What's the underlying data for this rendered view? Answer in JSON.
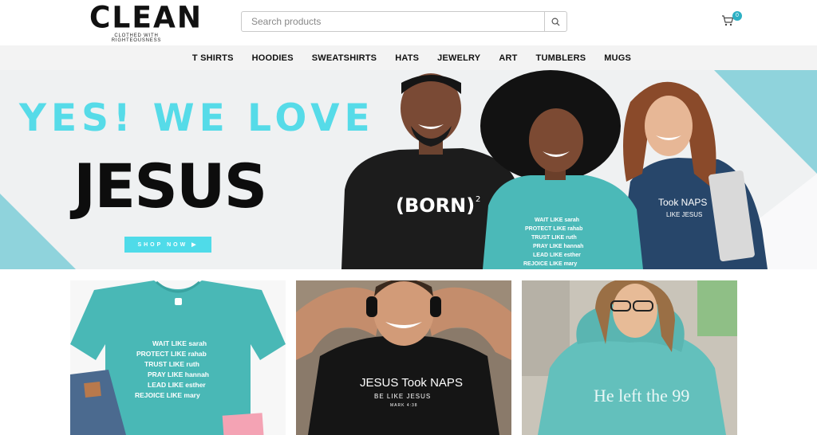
{
  "header": {
    "logo_title": "CLEAN",
    "logo_tagline": "CLOTHED WITH RIGHTEOUSNESS",
    "search_placeholder": "Search products",
    "cart_count": "0"
  },
  "nav": {
    "items": [
      "T SHIRTS",
      "HOODIES",
      "SWEATSHIRTS",
      "HATS",
      "JEWELRY",
      "ART",
      "TUMBLERS",
      "MUGS"
    ]
  },
  "hero": {
    "line1": "YES! WE LOVE",
    "line2": "JESUS",
    "cta": "SHOP NOW ▶",
    "shirt1": "(BORN)",
    "shirt1_sup": "2",
    "shirt2_lines": [
      "WAIT LIKE sarah",
      "PROTECT LIKE rahab",
      "TRUST LIKE ruth",
      "PRAY LIKE hannah",
      "LEAD LIKE esther",
      "REJOICE LIKE mary"
    ],
    "shirt3": "Took NAPS",
    "shirt3_sub": "LIKE JESUS"
  },
  "products": {
    "card1_lines": [
      "WAIT LIKE sarah",
      "PROTECT LIKE rahab",
      "TRUST LIKE ruth",
      "PRAY LIKE hannah",
      "LEAD LIKE esther",
      "REJOICE LIKE mary"
    ],
    "card2_title": "JESUS Took NAPS",
    "card2_sub": "BE LIKE JESUS",
    "card2_ref": "MARK 4:38",
    "card3_text": "He left the 99"
  },
  "colors": {
    "accent": "#4fdbe9",
    "teal_shirt": "#49b8b6",
    "cart_badge": "#2db0c4"
  }
}
